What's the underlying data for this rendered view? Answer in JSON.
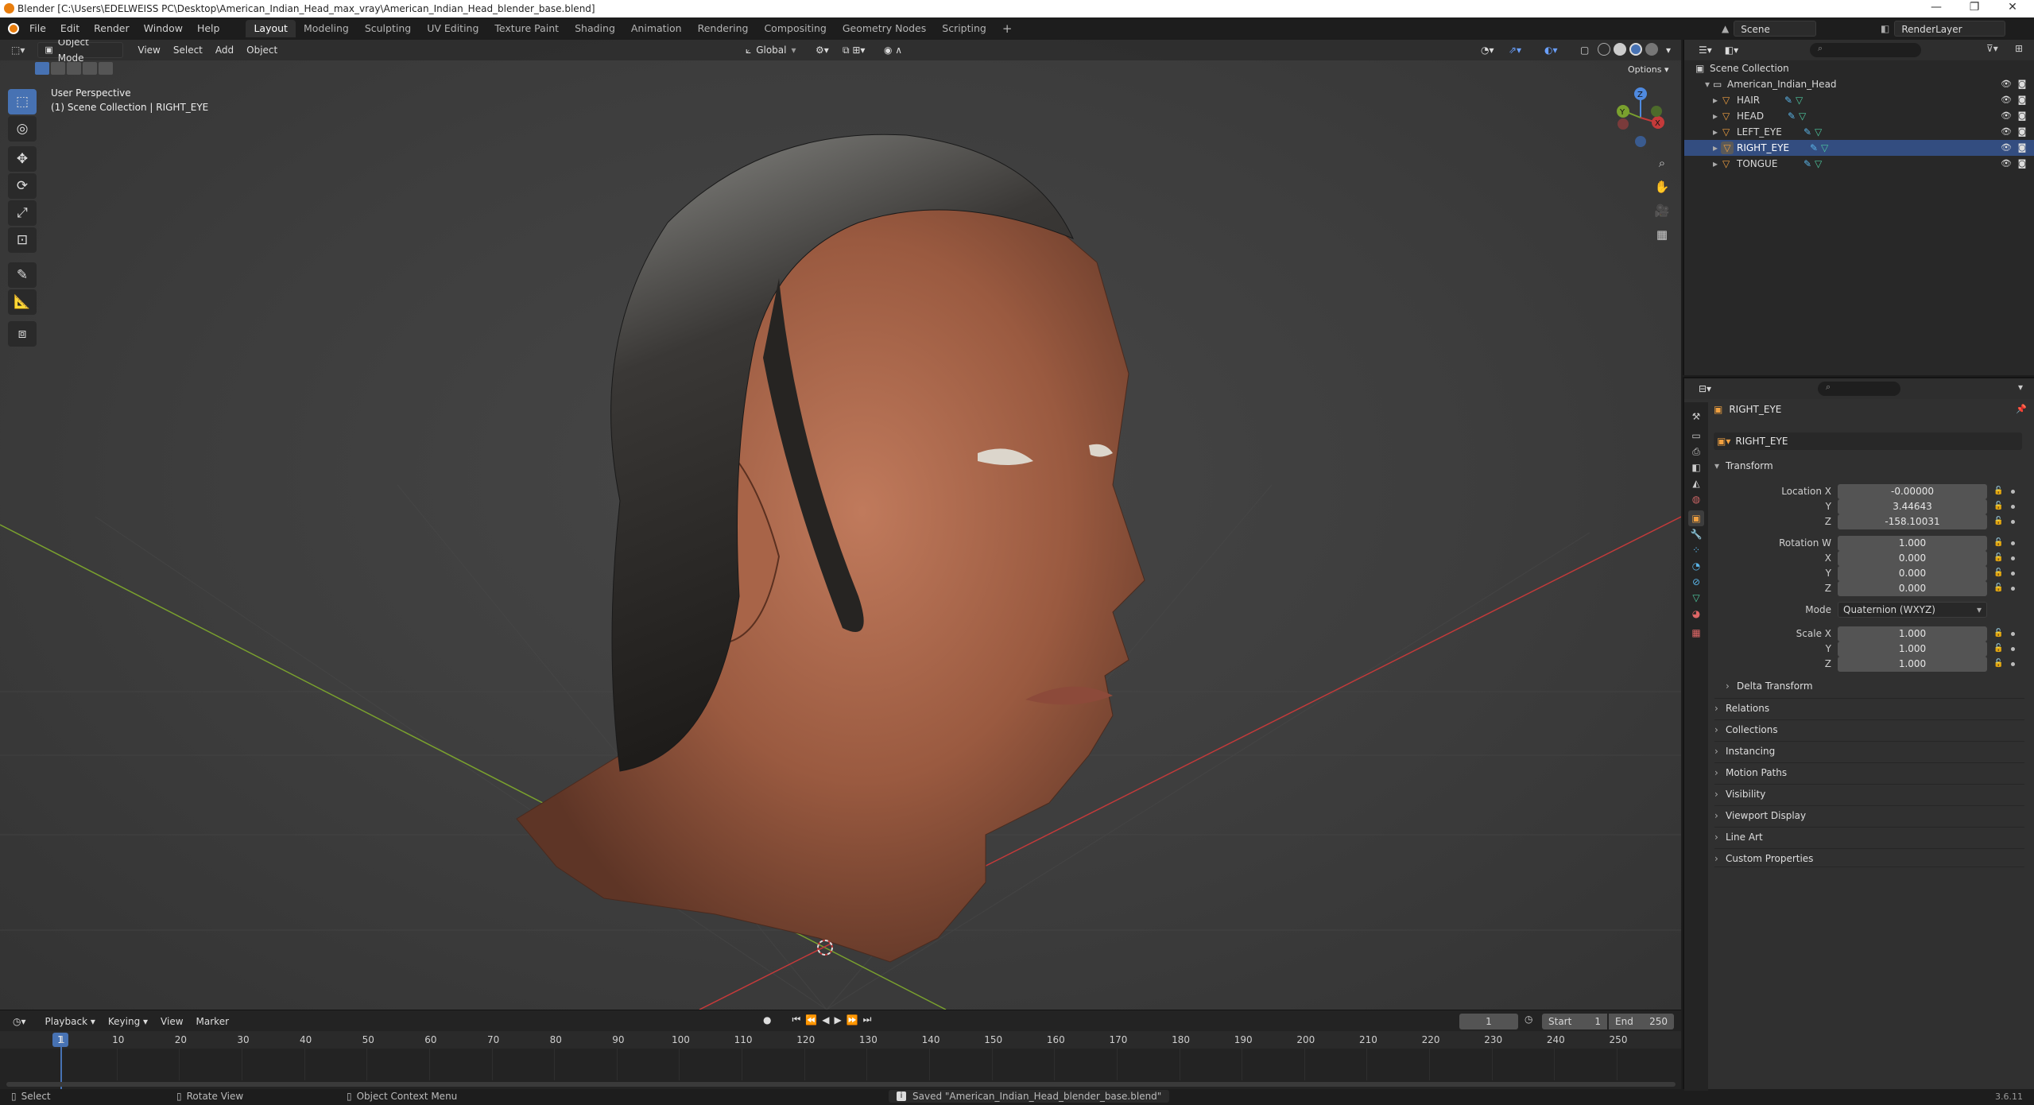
{
  "window": {
    "title": "Blender [C:\\Users\\EDELWEISS PC\\Desktop\\American_Indian_Head_max_vray\\American_Indian_Head_blender_base.blend]",
    "minimize": "—",
    "maximize": "❐",
    "close": "✕"
  },
  "menu": [
    "File",
    "Edit",
    "Render",
    "Window",
    "Help"
  ],
  "workspaces": [
    "Layout",
    "Modeling",
    "Sculpting",
    "UV Editing",
    "Texture Paint",
    "Shading",
    "Animation",
    "Rendering",
    "Compositing",
    "Geometry Nodes",
    "Scripting"
  ],
  "active_workspace": "Layout",
  "scene_name": "Scene",
  "view_layer": "RenderLayer",
  "viewport": {
    "mode": "Object Mode",
    "menus": [
      "View",
      "Select",
      "Add",
      "Object"
    ],
    "orientation": "Global",
    "options_label": "Options",
    "overlay_title": "User Perspective",
    "overlay_sub": "(1) Scene Collection | RIGHT_EYE",
    "gizmo_axes": [
      "Z",
      "Y",
      "X"
    ]
  },
  "outliner": {
    "root": "Scene Collection",
    "collection": "American_Indian_Head",
    "objects": [
      "HAIR",
      "HEAD",
      "LEFT_EYE",
      "RIGHT_EYE",
      "TONGUE"
    ],
    "active_object": "RIGHT_EYE"
  },
  "properties": {
    "object_name": "RIGHT_EYE",
    "data_name": "RIGHT_EYE",
    "transform_label": "Transform",
    "location_label": "Location X",
    "location": [
      "-0.00000",
      "3.44643",
      "-158.10031"
    ],
    "rotation_label": "Rotation W",
    "rotation": [
      "1.000",
      "0.000",
      "0.000",
      "0.000"
    ],
    "mode_label": "Mode",
    "mode_value": "Quaternion (WXYZ)",
    "scale_label": "Scale X",
    "scale": [
      "1.000",
      "1.000",
      "1.000"
    ],
    "axis_y": "Y",
    "axis_x": "X",
    "axis_z": "Z",
    "delta": "Delta Transform",
    "panels": [
      "Relations",
      "Collections",
      "Instancing",
      "Motion Paths",
      "Visibility",
      "Viewport Display",
      "Line Art",
      "Custom Properties"
    ]
  },
  "timeline": {
    "menus": [
      "Playback",
      "Keying",
      "View",
      "Marker"
    ],
    "current_frame": "1",
    "start_label": "Start",
    "start": "1",
    "end_label": "End",
    "end": "250",
    "ticks": [
      "1",
      "10",
      "20",
      "30",
      "40",
      "50",
      "60",
      "70",
      "80",
      "90",
      "100",
      "110",
      "120",
      "130",
      "140",
      "150",
      "160",
      "170",
      "180",
      "190",
      "200",
      "210",
      "220",
      "230",
      "240",
      "250"
    ]
  },
  "statusbar": {
    "select": "Select",
    "rotate": "Rotate View",
    "context": "Object Context Menu",
    "message": "Saved \"American_Indian_Head_blender_base.blend\"",
    "version": "3.6.11"
  }
}
